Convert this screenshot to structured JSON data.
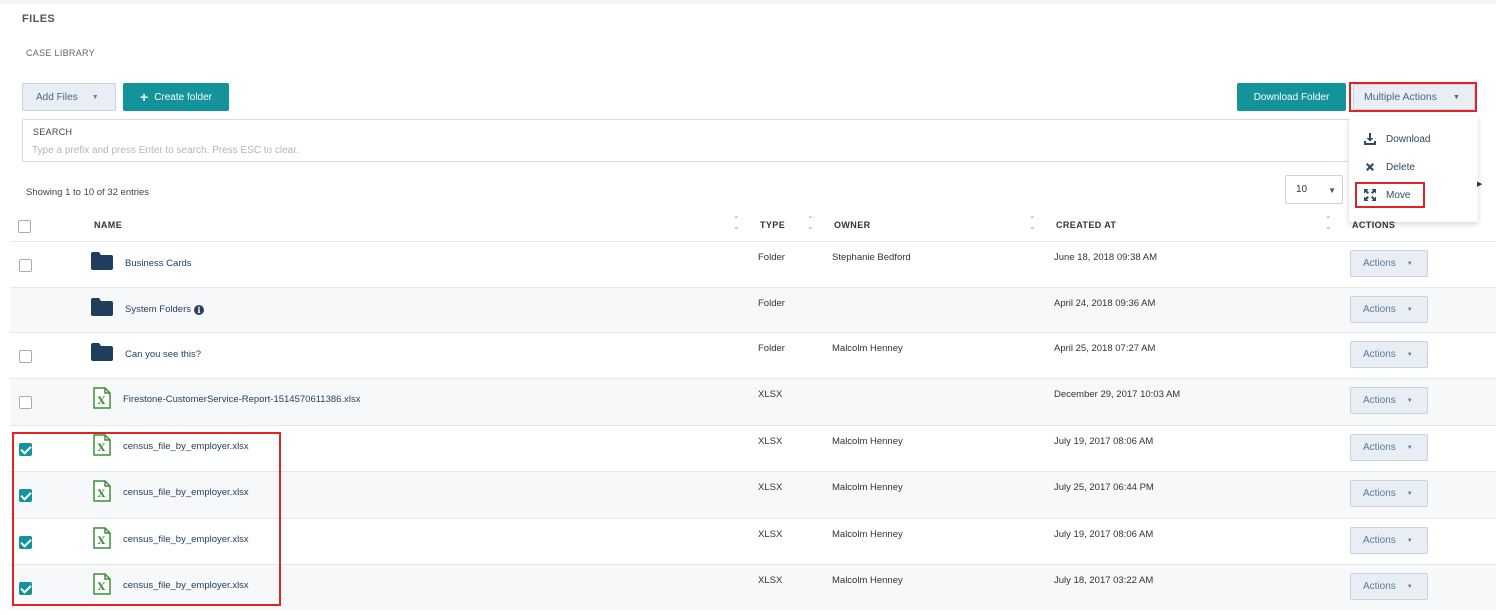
{
  "page": {
    "title": "FILES",
    "breadcrumb": "CASE LIBRARY"
  },
  "toolbar": {
    "add_files": "Add Files",
    "create_folder": "Create folder",
    "download_folder": "Download Folder",
    "multiple_actions": "Multiple Actions"
  },
  "multiple_actions_menu": {
    "download": "Download",
    "delete": "Delete",
    "move": "Move"
  },
  "search": {
    "label": "SEARCH",
    "placeholder": "Type a prefix and press Enter to search. Press ESC to clear."
  },
  "paging": {
    "showing": "Showing 1 to 10 of 32 entries",
    "per_page": "10"
  },
  "table": {
    "headers": {
      "name": "NAME",
      "type": "TYPE",
      "owner": "OWNER",
      "created_at": "CREATED AT",
      "actions": "ACTIONS"
    },
    "action_label": "Actions",
    "rows": [
      {
        "name": "Business Cards",
        "type": "Folder",
        "owner": "Stephanie Bedford",
        "created": "June 18, 2018 09:38 AM",
        "checked": false,
        "icon": "folder-icon"
      },
      {
        "name": "System Folders",
        "type": "Folder",
        "owner": "",
        "created": "April 24, 2018 09:36 AM",
        "checked": null,
        "icon": "folder-icon",
        "info": true
      },
      {
        "name": "Can you see this?",
        "type": "Folder",
        "owner": "Malcolm Henney",
        "created": "April 25, 2018 07:27 AM",
        "checked": false,
        "icon": "folder-icon"
      },
      {
        "name": "Firestone-CustomerService-Report-1514570611386.xlsx",
        "type": "XLSX",
        "owner": "",
        "created": "December 29, 2017 10:03 AM",
        "checked": false,
        "icon": "excel-file-icon"
      },
      {
        "name": "census_file_by_employer.xlsx",
        "type": "XLSX",
        "owner": "Malcolm Henney",
        "created": "July 19, 2017 08:06 AM",
        "checked": true,
        "icon": "excel-file-icon"
      },
      {
        "name": "census_file_by_employer.xlsx",
        "type": "XLSX",
        "owner": "Malcolm Henney",
        "created": "July 25, 2017 06:44 PM",
        "checked": true,
        "icon": "excel-file-icon"
      },
      {
        "name": "census_file_by_employer.xlsx",
        "type": "XLSX",
        "owner": "Malcolm Henney",
        "created": "July 19, 2017 08:06 AM",
        "checked": true,
        "icon": "excel-file-icon"
      },
      {
        "name": "census_file_by_employer.xlsx",
        "type": "XLSX",
        "owner": "Malcolm Henney",
        "created": "July 18, 2017 03:22 AM",
        "checked": true,
        "icon": "excel-file-icon"
      }
    ]
  },
  "colors": {
    "teal": "#13949a",
    "highlight": "#e02424",
    "folder": "#1f3d5c",
    "excel": "#3d8f3a"
  }
}
